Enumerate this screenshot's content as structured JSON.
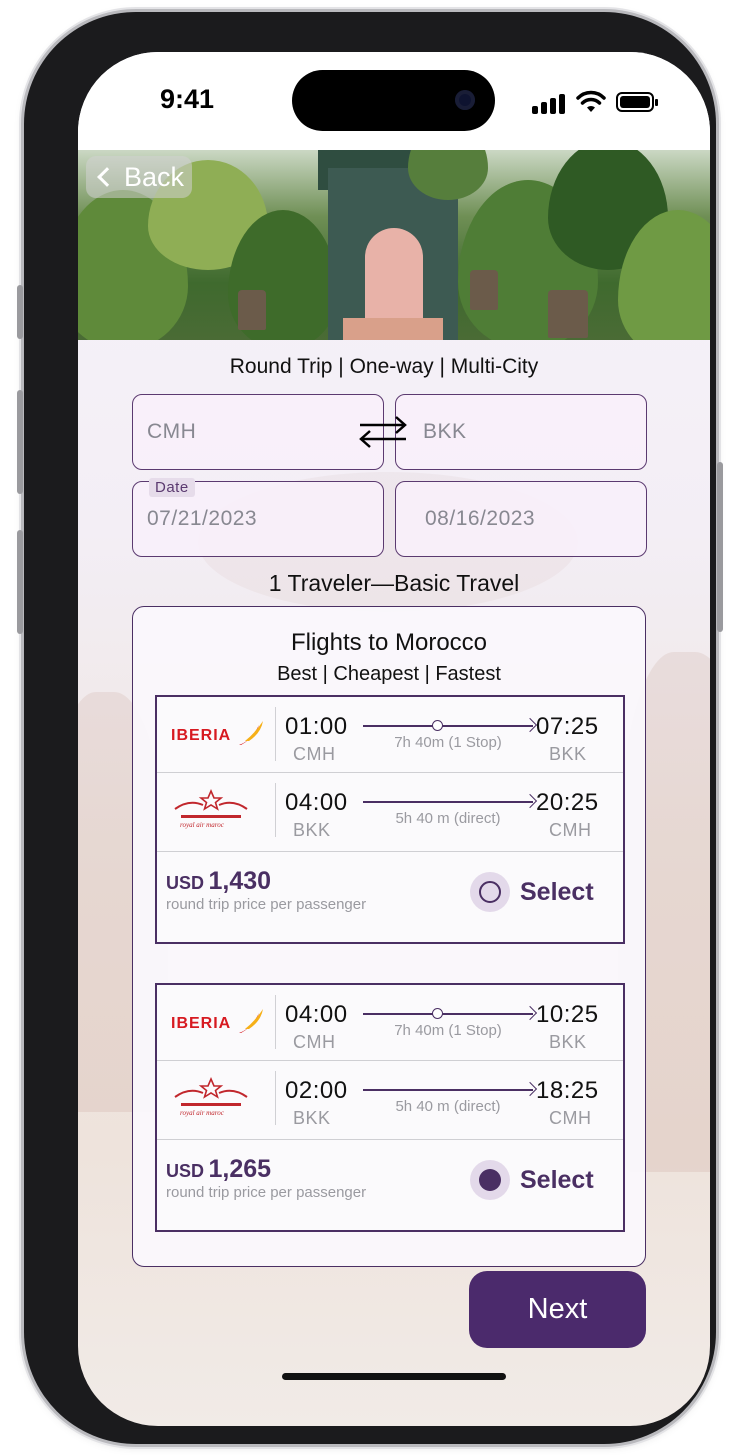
{
  "status_bar": {
    "time": "9:41"
  },
  "header": {
    "back_label": "Back"
  },
  "trip_type": "Round Trip | One-way | Multi-City",
  "route": {
    "origin": "CMH",
    "destination": "BKK"
  },
  "dates": {
    "label": "Date",
    "depart": "07/21/2023",
    "return": "08/16/2023"
  },
  "traveler_summary": "1 Traveler—Basic Travel",
  "results": {
    "title": "Flights to Morocco",
    "sort_options": "Best | Cheapest | Fastest",
    "options": [
      {
        "legs": [
          {
            "airline": "IBERIA",
            "depart_time": "01:00",
            "depart_code": "CMH",
            "duration": "7h 40m (1 Stop)",
            "arrive_time": "07:25",
            "arrive_code": "BKK"
          },
          {
            "airline": "royal air maroc",
            "depart_time": "04:00",
            "depart_code": "BKK",
            "duration": "5h 40 m (direct)",
            "arrive_time": "20:25",
            "arrive_code": "CMH"
          }
        ],
        "price_currency": "USD",
        "price_amount": "1,430",
        "price_note": "round trip price per passenger",
        "select_label": "Select",
        "selected": false
      },
      {
        "legs": [
          {
            "airline": "IBERIA",
            "depart_time": "04:00",
            "depart_code": "CMH",
            "duration": "7h 40m (1 Stop)",
            "arrive_time": "10:25",
            "arrive_code": "BKK"
          },
          {
            "airline": "royal air maroc",
            "depart_time": "02:00",
            "depart_code": "BKK",
            "duration": "5h 40 m (direct)",
            "arrive_time": "18:25",
            "arrive_code": "CMH"
          }
        ],
        "price_currency": "USD",
        "price_amount": "1,265",
        "price_note": "round trip price per passenger",
        "select_label": "Select",
        "selected": true
      }
    ]
  },
  "next_label": "Next",
  "colors": {
    "accent": "#4b2a6c",
    "iberia_red": "#d71a21",
    "iberia_yellow": "#f6b018",
    "ram_red": "#c1272d"
  },
  "icons": [
    "chevron-left-icon",
    "swap-arrows-icon",
    "cellular-signal-icon",
    "wifi-icon",
    "battery-icon",
    "radio-unselected-icon",
    "radio-selected-icon"
  ]
}
